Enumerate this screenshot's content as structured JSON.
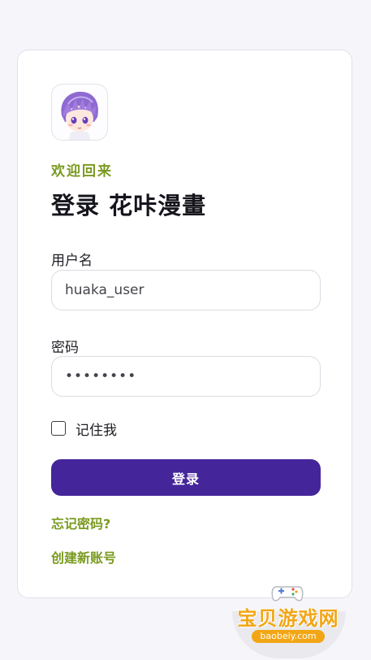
{
  "login": {
    "welcome": "欢迎回来",
    "title": "登录 花咔漫畫",
    "username_label": "用户名",
    "username_value": "huaka_user",
    "password_label": "密码",
    "password_value": "••••••••",
    "remember_label": "记住我",
    "remember_checked": false,
    "login_button": "登录",
    "forgot_link": "忘记密码?",
    "register_link": "创建新账号"
  },
  "watermark": {
    "text": "宝贝游戏网",
    "url": "baobeiy.com"
  },
  "colors": {
    "accent": "#7a9a1f",
    "primary": "#45259a",
    "background": "#f6f5fa"
  },
  "icons": {
    "avatar": "anime-avatar",
    "watermark_logo": "gamepad-icon"
  }
}
